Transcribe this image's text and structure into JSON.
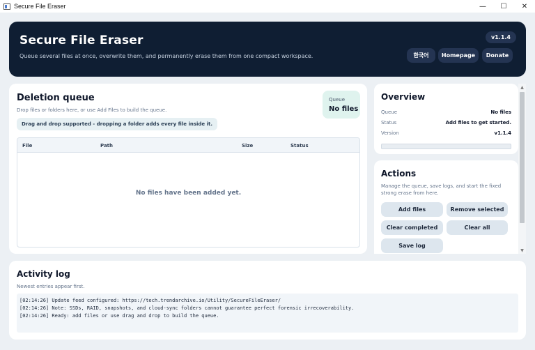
{
  "window": {
    "title": "Secure File Eraser",
    "icon": "app-window-icon",
    "controls": {
      "minimize": "—",
      "maximize": "☐",
      "close": "✕"
    }
  },
  "header": {
    "title": "Secure File Eraser",
    "subtitle": "Queue several files at once, overwrite them, and permanently erase them from one compact workspace.",
    "version": "v1.1.4",
    "buttons": {
      "language": "한국어",
      "homepage": "Homepage",
      "donate": "Donate"
    }
  },
  "queue": {
    "heading": "Deletion queue",
    "subtitle": "Drop files or folders here, or use Add Files to build the queue.",
    "hint": "Drag and drop supported - dropping a folder adds every file inside it.",
    "badge": {
      "label": "Queue",
      "value": "No files"
    },
    "columns": [
      "File",
      "Path",
      "Size",
      "Status"
    ],
    "empty_message": "No files have been added yet."
  },
  "overview": {
    "heading": "Overview",
    "rows": [
      {
        "key": "Queue",
        "value": "No files"
      },
      {
        "key": "Status",
        "value": "Add files to get started."
      },
      {
        "key": "Version",
        "value": "v1.1.4"
      }
    ],
    "progress": 0
  },
  "actions": {
    "heading": "Actions",
    "description": "Manage the queue, save logs, and start the fixed strong erase from here.",
    "buttons": {
      "add_files": "Add files",
      "remove_selected": "Remove selected",
      "clear_completed": "Clear completed",
      "clear_all": "Clear all",
      "save_log": "Save log"
    }
  },
  "activity": {
    "heading": "Activity log",
    "subtitle": "Newest entries appear first.",
    "lines": [
      "[02:14:26] Update feed configured: https://tech.trendarchive.io/Utility/SecureFileEraser/",
      "[02:14:26] Note: SSDs, RAID, snapshots, and cloud-sync folders cannot guarantee perfect forensic irrecoverability.",
      "[02:14:26] Ready: add files or use drag and drop to build the queue."
    ]
  },
  "colors": {
    "header_bg": "#0f1e33",
    "badge_bg": "#dff3ee",
    "button_bg": "#dde6ee",
    "page_bg": "#ecf0f4"
  }
}
